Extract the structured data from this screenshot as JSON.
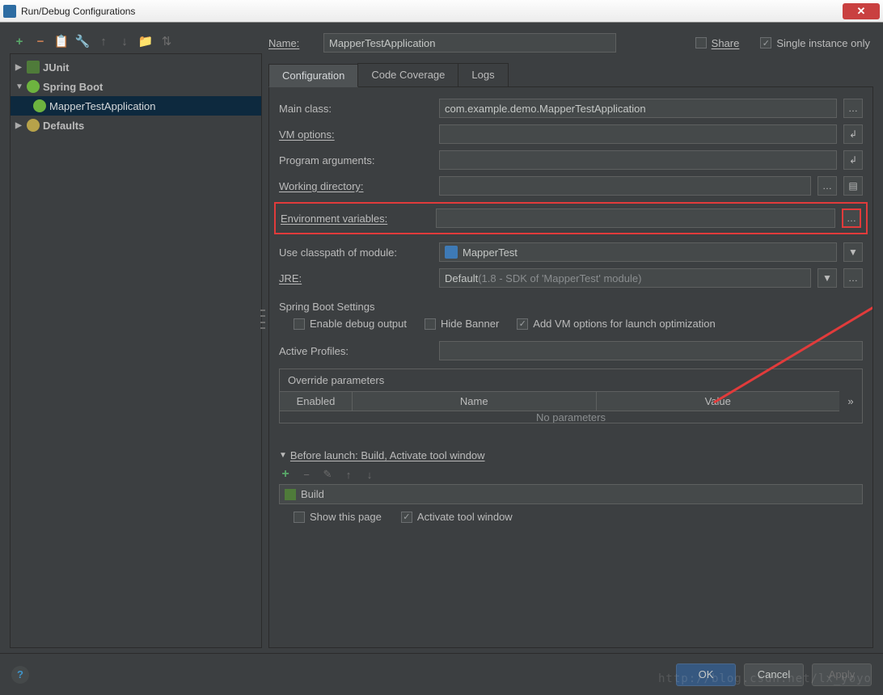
{
  "window": {
    "title": "Run/Debug Configurations"
  },
  "tree": {
    "junit": "JUnit",
    "springboot": "Spring Boot",
    "app": "MapperTestApplication",
    "defaults": "Defaults"
  },
  "name": {
    "label": "Name:",
    "value": "MapperTestApplication"
  },
  "share": {
    "label": "Share"
  },
  "single": {
    "label": "Single instance only"
  },
  "tabs": {
    "config": "Configuration",
    "coverage": "Code Coverage",
    "logs": "Logs"
  },
  "form": {
    "mainclass_label": "Main class:",
    "mainclass_value": "com.example.demo.MapperTestApplication",
    "vm_label": "VM options:",
    "args_label": "Program arguments:",
    "workdir_label": "Working directory:",
    "env_label": "Environment variables:",
    "classpath_label": "Use classpath of module:",
    "classpath_value": "MapperTest",
    "jre_label": "JRE:",
    "jre_value": "Default ",
    "jre_hint": "(1.8 - SDK of 'MapperTest' module)",
    "sb_settings": "Spring Boot Settings",
    "enable_debug": "Enable debug output",
    "hide_banner": "Hide Banner",
    "add_vm": "Add VM options for launch optimization",
    "active_profiles": "Active Profiles:",
    "override_title": "Override parameters",
    "col_enabled": "Enabled",
    "col_name": "Name",
    "col_value": "Value",
    "no_params": "No parameters"
  },
  "before": {
    "title": "Before launch: Build, Activate tool window",
    "build": "Build",
    "show_page": "Show this page",
    "activate": "Activate tool window"
  },
  "footer": {
    "ok": "OK",
    "cancel": "Cancel",
    "apply": "Apply"
  },
  "watermark": "http://blog.csdn.net/lx_yoyo"
}
